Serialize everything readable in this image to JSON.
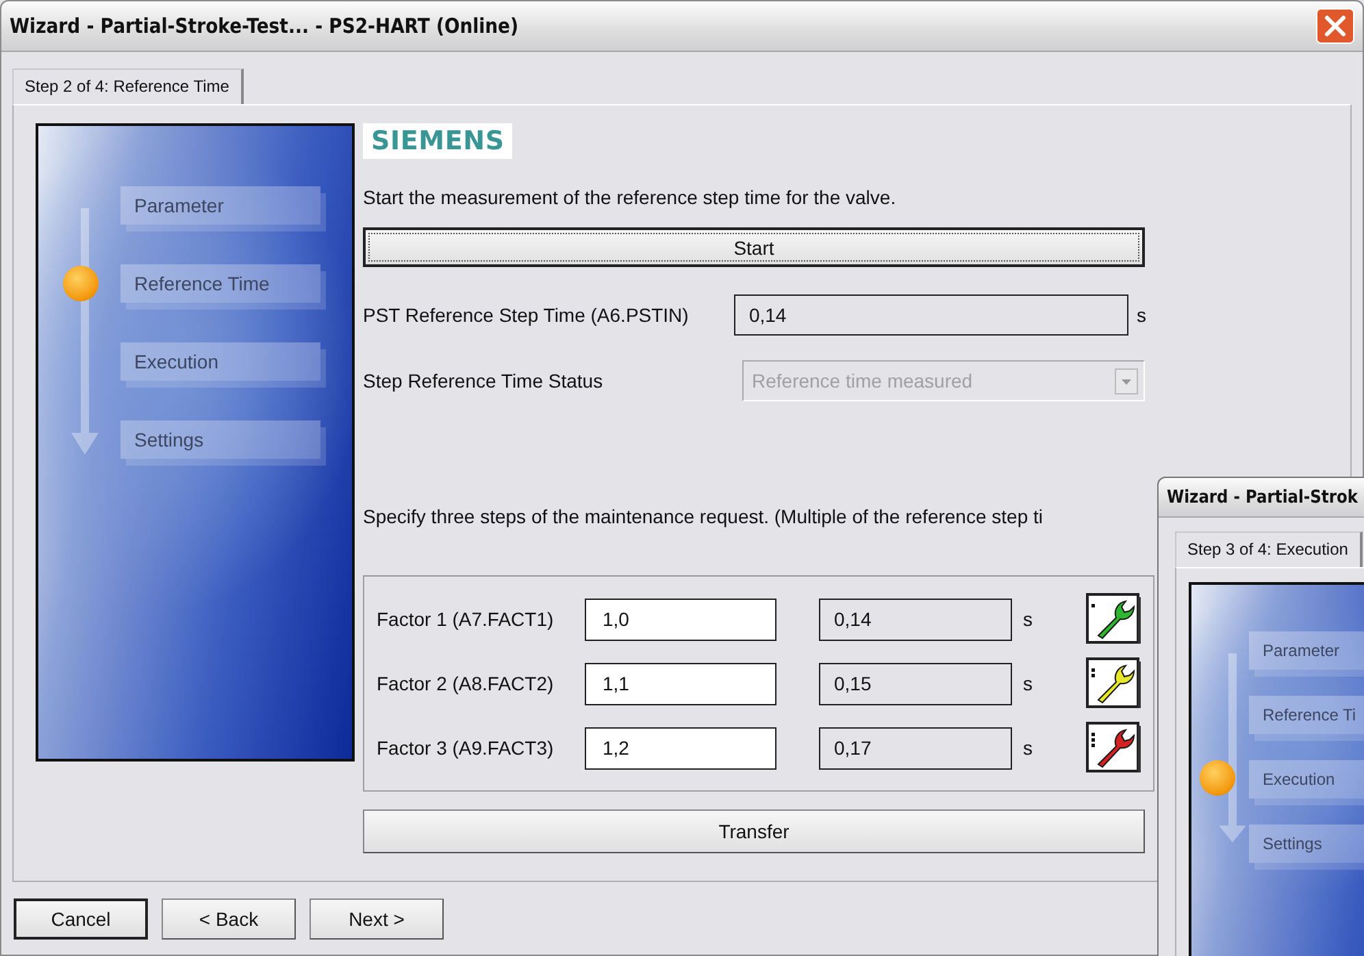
{
  "window": {
    "title": "Wizard - Partial-Stroke-Test... - PS2-HART (Online)"
  },
  "tabs": [
    {
      "label": "Step 2 of 4: Reference Time",
      "selected": true
    }
  ],
  "steps": [
    {
      "label": "Parameter",
      "current": false
    },
    {
      "label": "Reference Time",
      "current": true
    },
    {
      "label": "Execution",
      "current": false
    },
    {
      "label": "Settings",
      "current": false
    }
  ],
  "logo": "SIEMENS",
  "intro": "Start the measurement of the reference step time for the valve.",
  "start_button": "Start",
  "reference_time": {
    "label": "PST Reference Step Time (A6.PSTIN)",
    "value": "0,14",
    "unit": "s"
  },
  "status": {
    "label": "Step Reference Time Status",
    "value": "Reference time measured",
    "disabled": true
  },
  "factors_intro": "Specify three steps of the maintenance request. (Multiple of the reference step ti",
  "factors": [
    {
      "label": "Factor 1 (A7.FACT1)",
      "value": "1,0",
      "time": "0,14",
      "unit": "s",
      "color": "#2fb82f"
    },
    {
      "label": "Factor 2 (A8.FACT2)",
      "value": "1,1",
      "time": "0,15",
      "unit": "s",
      "color": "#e6e62a"
    },
    {
      "label": "Factor 3 (A9.FACT3)",
      "value": "1,2",
      "time": "0,17",
      "unit": "s",
      "color": "#d42222"
    }
  ],
  "transfer_button": "Transfer",
  "buttons": [
    {
      "label": "Cancel",
      "default": true
    },
    {
      "label": "< Back",
      "default": false
    },
    {
      "label": "Next >",
      "default": false
    }
  ],
  "second_window": {
    "title": "Wizard - Partial-Strok",
    "tabs": [
      {
        "label": "Step 3 of 4: Execution",
        "selected": true
      }
    ],
    "steps": [
      {
        "label": "Parameter",
        "current": false
      },
      {
        "label": "Reference Ti",
        "current": false
      },
      {
        "label": "Execution",
        "current": true
      },
      {
        "label": "Settings",
        "current": false
      }
    ]
  }
}
